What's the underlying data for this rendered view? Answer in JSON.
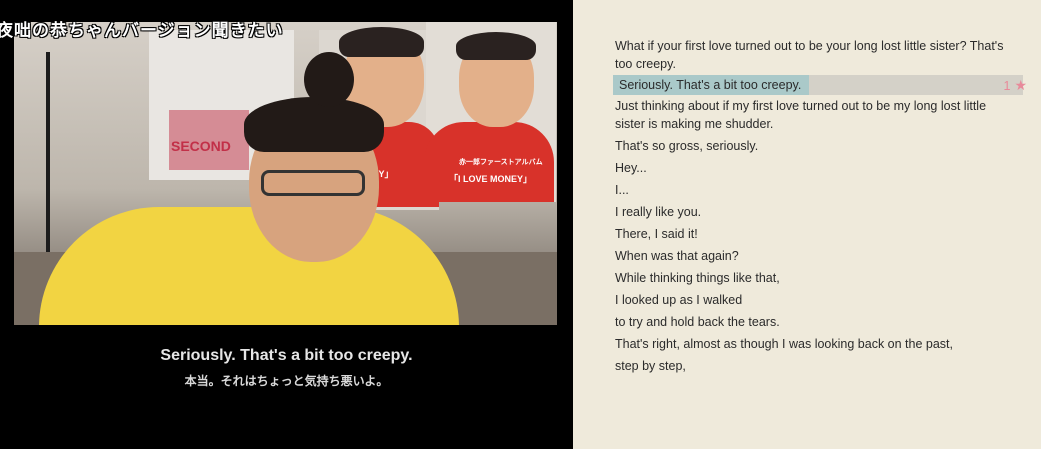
{
  "player": {
    "danmaku": "夜咄の恭ちゃんバージョン聞きたい",
    "poster_text_b": "ONEY」",
    "poster_text_c_1": "赤一郎ファーストアルバム",
    "poster_text_c_2": "「I LOVE MONEY」",
    "poster_text_a": "SECOND",
    "subtitle_en": "Seriously. That's a bit too creepy.",
    "subtitle_ja": "本当。それはちょっと気持ち悪いよ。"
  },
  "transcript": {
    "lines": [
      "What if your first love turned out to be your long lost little sister? That's too creepy.",
      "Seriously. That's a bit too creepy.",
      "Just thinking about if my first love turned out to be my long lost little sister is making me shudder.",
      "That's so gross, seriously.",
      "Hey...",
      "I...",
      "I really like you.",
      "There, I said it!",
      "When was that again?",
      "While thinking things like that,",
      "I looked up as I walked",
      "to try and hold back the tears.",
      "That's right, almost as though I was looking back on the past,",
      "step by step,"
    ],
    "active_index": 1,
    "active_star_count": "1",
    "star_icon": "★"
  },
  "colors": {
    "panel_bg": "#efeadb",
    "highlight": "#aac9c9",
    "star": "#e88a9a"
  }
}
